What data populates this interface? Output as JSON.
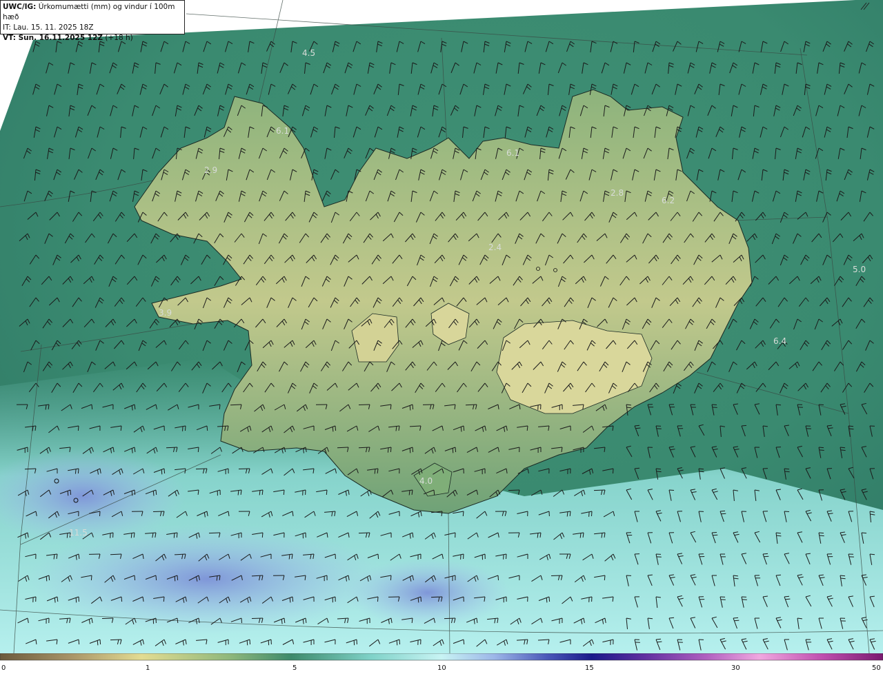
{
  "header": {
    "model": "UWC/IG:",
    "title": "Úrkomumætti (mm) og vindur í 100m hæð",
    "init_time": "IT: Lau. 15. 11. 2025 18Z",
    "valid_time": "VT: Sun. 16.11.2025 12Z",
    "lead": "(+18 h)"
  },
  "map_labels": [
    {
      "text": "4.5"
    },
    {
      "text": "6.1"
    },
    {
      "text": "2.9"
    },
    {
      "text": "6.1"
    },
    {
      "text": "2.8"
    },
    {
      "text": "6.2"
    },
    {
      "text": "2.4"
    },
    {
      "text": "5.0"
    },
    {
      "text": "3.9"
    },
    {
      "text": "6.4"
    },
    {
      "text": "4.0"
    },
    {
      "text": "11.5"
    }
  ],
  "legend": {
    "ticks": [
      "0",
      "1",
      "5",
      "10",
      "15",
      "30",
      "50"
    ],
    "colors": [
      "#6b5a3c",
      "#b9a574",
      "#e3dc92",
      "#7fae78",
      "#3d8a6b",
      "#8fd6d0",
      "#bfeff0",
      "#9cb6e8",
      "#4a58b8",
      "#1a1a8a",
      "#7a3aa8",
      "#c86ac8",
      "#f0a8e0",
      "#c050b0",
      "#7a1a70"
    ]
  },
  "colors": {
    "sea_dark": "#2f7a68",
    "sea_light": "#9ee3e0",
    "land_low": "#3d8a6b",
    "land_high": "#d6d79a",
    "blue_precip": "#8aa3df"
  }
}
